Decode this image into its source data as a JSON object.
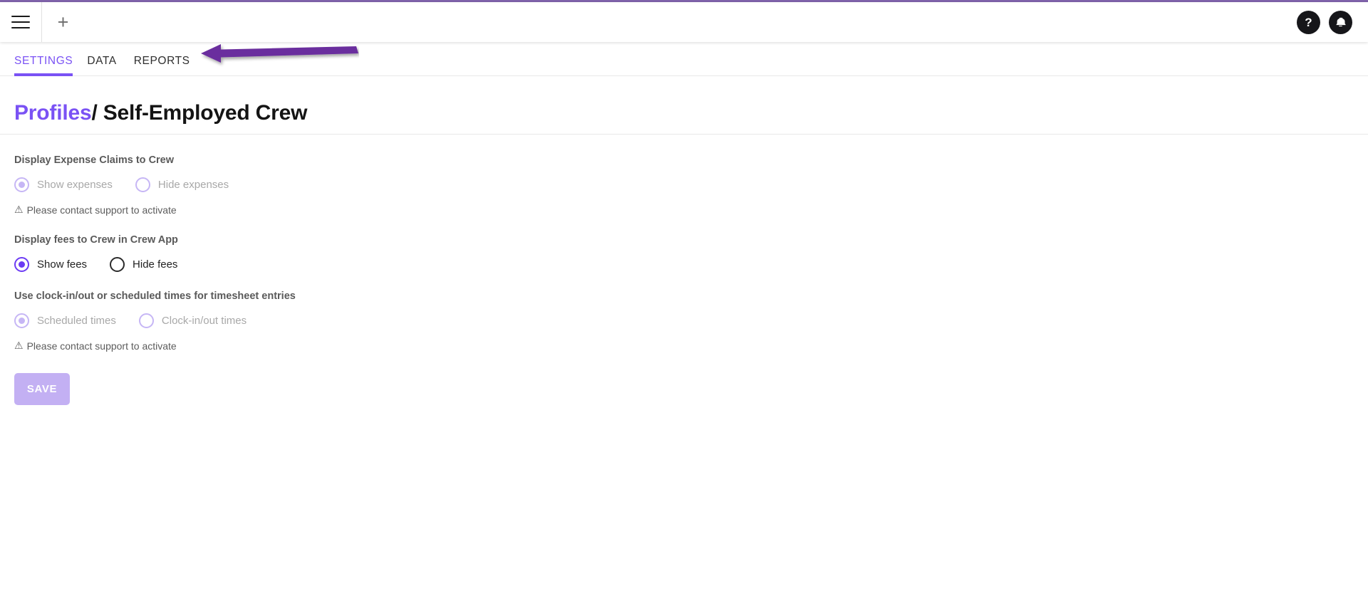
{
  "theme": {
    "accent_purple": "#7a52f4",
    "radio_purple": "#6c3bf4",
    "disabled_purple": "#c6b6f5",
    "save_button_bg": "#c3b0f3",
    "top_accent_bar": "#8063ab",
    "annotation_arrow": "#6b2f9e"
  },
  "topbar": {
    "menu_icon": "hamburger-menu-icon",
    "add_label": "+",
    "add_icon": "plus-icon",
    "help_label": "?",
    "help_icon": "help-question-icon",
    "notifications_icon": "bell-icon"
  },
  "tabs": [
    {
      "label": "SETTINGS",
      "active": true
    },
    {
      "label": "DATA",
      "active": false
    },
    {
      "label": "REPORTS",
      "active": false
    }
  ],
  "breadcrumb": {
    "parent": "Profiles",
    "separator": "/",
    "current": "Self-Employed Crew"
  },
  "form": {
    "groups": [
      {
        "label": "Display Expense Claims to Crew",
        "disabled": true,
        "options": [
          {
            "label": "Show expenses",
            "selected": true
          },
          {
            "label": "Hide expenses",
            "selected": false
          }
        ],
        "note": "Please contact support to activate",
        "note_icon": "warning-triangle-icon"
      },
      {
        "label": "Display fees to Crew in Crew App",
        "disabled": false,
        "options": [
          {
            "label": "Show fees",
            "selected": true
          },
          {
            "label": "Hide fees",
            "selected": false
          }
        ],
        "note": "",
        "note_icon": ""
      },
      {
        "label": "Use clock-in/out or scheduled times for timesheet entries",
        "disabled": true,
        "options": [
          {
            "label": "Scheduled times",
            "selected": true
          },
          {
            "label": "Clock-in/out times",
            "selected": false
          }
        ],
        "note": "Please contact support to activate",
        "note_icon": "warning-triangle-icon"
      }
    ],
    "save_label": "SAVE"
  },
  "annotation": {
    "type": "arrow-pointing-left",
    "name": "annotation-arrow"
  }
}
